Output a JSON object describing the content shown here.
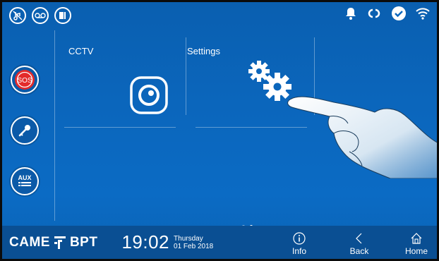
{
  "status_icons_left": [
    "mute-icon",
    "voicemail-icon",
    "door-icon"
  ],
  "status_icons_right": [
    "bell-icon",
    "link-icon",
    "check-icon",
    "wifi-icon"
  ],
  "sidebar": {
    "sos_label": "SOS",
    "aux_label": "AUX"
  },
  "tiles": {
    "cctv_label": "CCTV",
    "settings_label": "Settings"
  },
  "footer": {
    "brand_left": "CAME",
    "brand_right": "BPT",
    "time": "19:02",
    "day": "Thursday",
    "date": "01 Feb 2018",
    "info_label": "Info",
    "back_label": "Back",
    "home_label": "Home"
  },
  "pager": {
    "pages": 2,
    "current": 2
  },
  "colors": {
    "background": "#0b66bc",
    "footer": "#0a4f93",
    "sos_red": "#e32b2b"
  }
}
